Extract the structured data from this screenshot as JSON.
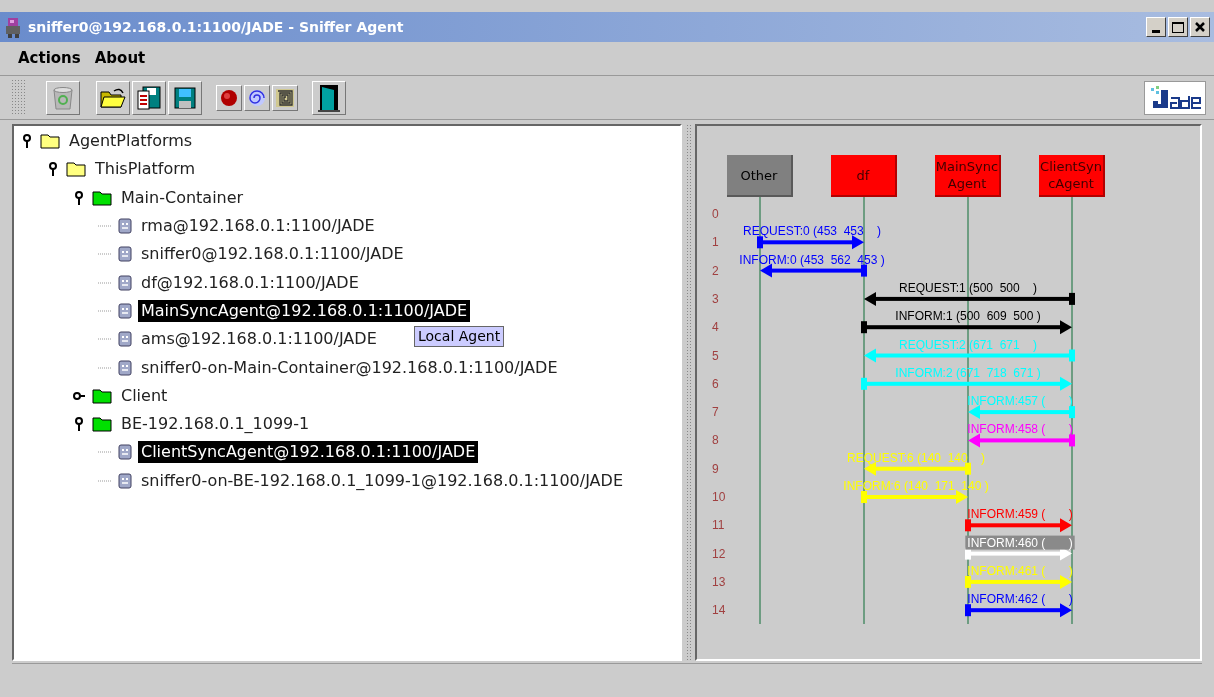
{
  "window": {
    "title": "sniffer0@192.168.0.1:1100/JADE - Sniffer Agent"
  },
  "menu": [
    "Actions",
    "About"
  ],
  "tree": [
    {
      "label": "AgentPlatforms",
      "kind": "platform",
      "expanded": true,
      "selected": false,
      "children": [
        {
          "label": "ThisPlatform",
          "kind": "platform",
          "expanded": true,
          "selected": false,
          "children": [
            {
              "label": "Main-Container",
              "kind": "container",
              "expanded": true,
              "selected": false,
              "children": [
                {
                  "label": "rma@192.168.0.1:1100/JADE",
                  "kind": "agent",
                  "selected": false
                },
                {
                  "label": "sniffer0@192.168.0.1:1100/JADE",
                  "kind": "agent",
                  "selected": false
                },
                {
                  "label": "df@192.168.0.1:1100/JADE",
                  "kind": "agent",
                  "selected": false
                },
                {
                  "label": "MainSyncAgent@192.168.0.1:1100/JADE",
                  "kind": "agent",
                  "selected": true
                },
                {
                  "label": "ams@192.168.0.1:1100/JADE",
                  "kind": "agent",
                  "selected": false
                },
                {
                  "label": "sniffer0-on-Main-Container@192.168.0.1:1100/JADE",
                  "kind": "agent",
                  "selected": false
                }
              ]
            },
            {
              "label": "Client",
              "kind": "container",
              "expanded": false,
              "selected": false
            },
            {
              "label": "BE-192.168.0.1_1099-1",
              "kind": "container",
              "expanded": true,
              "selected": false,
              "children": [
                {
                  "label": "ClientSyncAgent@192.168.0.1:1100/JADE",
                  "kind": "agent",
                  "selected": true
                },
                {
                  "label": "sniffer0-on-BE-192.168.0.1_1099-1@192.168.0.1:1100/JADE",
                  "kind": "agent",
                  "selected": false
                }
              ]
            }
          ]
        }
      ]
    }
  ],
  "tooltip": "Local Agent",
  "diagram": {
    "agents": [
      {
        "name": "Other",
        "color": "#808080"
      },
      {
        "name": "df",
        "color": "#ff0000"
      },
      {
        "name": "MainSyncAgent",
        "color": "#ff0000"
      },
      {
        "name": "ClientSyncAgent",
        "color": "#ff0000"
      }
    ],
    "rows": [
      {
        "number": "0"
      },
      {
        "number": "1",
        "message": {
          "label": "REQUEST:0 (453  453    )",
          "color": "#0000ff",
          "lanes": [
            {
              "kind": "tail"
            },
            {
              "kind": "head"
            },
            {
              "kind": "none"
            },
            {
              "kind": "none"
            }
          ]
        }
      },
      {
        "number": "2",
        "message": {
          "label": "INFORM:0 (453  562  453 )",
          "color": "#0000ff",
          "lanes": [
            {
              "kind": "head"
            },
            {
              "kind": "tail"
            },
            {
              "kind": "none"
            },
            {
              "kind": "none"
            }
          ]
        }
      },
      {
        "number": "3",
        "message": {
          "label": "REQUEST:1 (500  500    )",
          "color": "#000000",
          "lanes": [
            {
              "kind": "none"
            },
            {
              "kind": "head"
            },
            {
              "kind": "none"
            },
            {
              "kind": "tail"
            }
          ]
        }
      },
      {
        "number": "4",
        "message": {
          "label": "INFORM:1 (500  609  500 )",
          "color": "#000000",
          "lanes": [
            {
              "kind": "none"
            },
            {
              "kind": "tail"
            },
            {
              "kind": "none"
            },
            {
              "kind": "head"
            }
          ]
        }
      },
      {
        "number": "5",
        "message": {
          "label": "REQUEST:2 (671  671    )",
          "color": "#00ffff",
          "lanes": [
            {
              "kind": "none"
            },
            {
              "kind": "head"
            },
            {
              "kind": "none"
            },
            {
              "kind": "tail"
            }
          ]
        }
      },
      {
        "number": "6",
        "message": {
          "label": "INFORM:2 (671  718  671 )",
          "color": "#00ffff",
          "lanes": [
            {
              "kind": "none"
            },
            {
              "kind": "tail"
            },
            {
              "kind": "none"
            },
            {
              "kind": "head"
            }
          ]
        }
      },
      {
        "number": "7",
        "message": {
          "label": "INFORM:457 (       )",
          "color": "#00ffff",
          "lanes": [
            {
              "kind": "none"
            },
            {
              "kind": "none"
            },
            {
              "kind": "head"
            },
            {
              "kind": "tail"
            }
          ]
        }
      },
      {
        "number": "8",
        "message": {
          "label": "INFORM:458 (       )",
          "color": "#ff00ff",
          "lanes": [
            {
              "kind": "none"
            },
            {
              "kind": "none"
            },
            {
              "kind": "head"
            },
            {
              "kind": "tail"
            }
          ]
        }
      },
      {
        "number": "9",
        "message": {
          "label": "REQUEST:6 (140  140    )",
          "color": "#ffff00",
          "lanes": [
            {
              "kind": "none"
            },
            {
              "kind": "head"
            },
            {
              "kind": "tail"
            },
            {
              "kind": "none"
            }
          ]
        }
      },
      {
        "number": "10",
        "message": {
          "label": "INFORM:6 (140  171  140 )",
          "color": "#ffff00",
          "lanes": [
            {
              "kind": "none"
            },
            {
              "kind": "tail"
            },
            {
              "kind": "head"
            },
            {
              "kind": "none"
            }
          ]
        }
      },
      {
        "number": "11",
        "message": {
          "label": "INFORM:459 (       )",
          "color": "#ff0000",
          "lanes": [
            {
              "kind": "none"
            },
            {
              "kind": "none"
            },
            {
              "kind": "tail"
            },
            {
              "kind": "head"
            }
          ]
        }
      },
      {
        "number": "12",
        "message": {
          "label": "INFORM:460 (       )",
          "color": "#ffffff",
          "lanes": [
            {
              "kind": "none"
            },
            {
              "kind": "none"
            },
            {
              "kind": "tail"
            },
            {
              "kind": "head"
            }
          ]
        }
      },
      {
        "number": "13",
        "message": {
          "label": "INFORM:461 (       )",
          "color": "#ffff00",
          "lanes": [
            {
              "kind": "none"
            },
            {
              "kind": "none"
            },
            {
              "kind": "tail"
            },
            {
              "kind": "head"
            }
          ]
        }
      },
      {
        "number": "14",
        "message": {
          "label": "INFORM:462 (       )",
          "color": "#0000ff",
          "lanes": [
            {
              "kind": "none"
            },
            {
              "kind": "none"
            },
            {
              "kind": "tail"
            },
            {
              "kind": "head"
            }
          ]
        }
      }
    ]
  }
}
